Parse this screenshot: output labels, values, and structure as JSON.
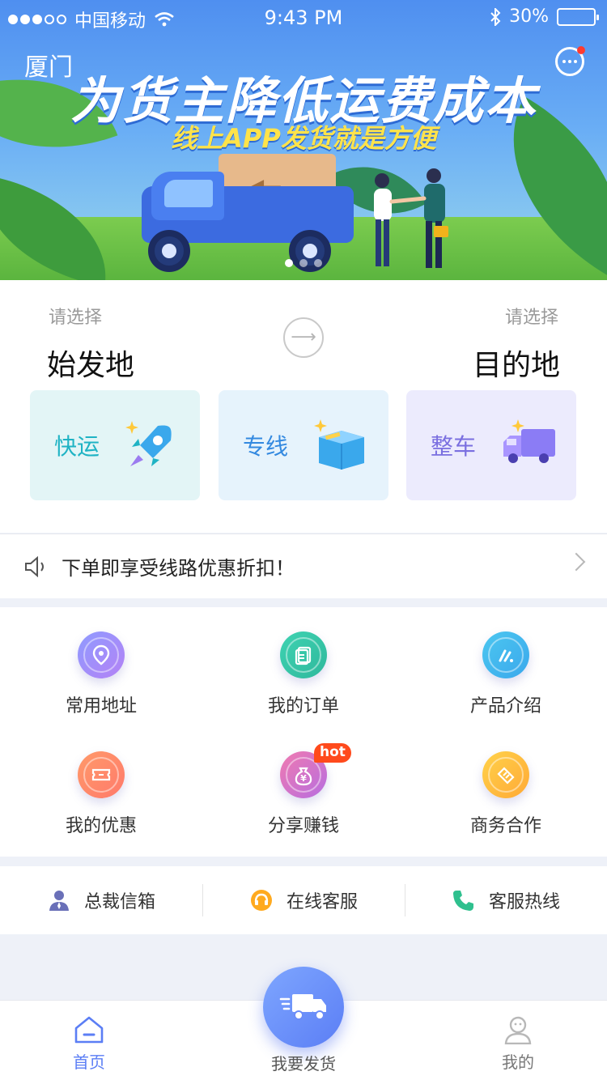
{
  "status_bar": {
    "carrier": "中国移动",
    "time": "9:43 PM",
    "battery": "30%",
    "battery_level": 0.3
  },
  "banner": {
    "city": "厦门",
    "headline": "为货主降低运费成本",
    "subline": "线上APP发货就是方便",
    "carousel": {
      "count": 3,
      "active": 0
    }
  },
  "route": {
    "origin_hint": "请选择",
    "origin": "始发地",
    "destination_hint": "请选择",
    "destination": "目的地"
  },
  "services": [
    {
      "label": "快运",
      "icon": "rocket-icon",
      "color": "#1fb3c4",
      "bg": "#e3f5f6"
    },
    {
      "label": "专线",
      "icon": "box-icon",
      "color": "#3389e0",
      "bg": "#e6f3fc"
    },
    {
      "label": "整车",
      "icon": "truck-icon",
      "color": "#7a6fe0",
      "bg": "#ecebfd"
    }
  ],
  "notice": {
    "text": "下单即享受线路优惠折扣！"
  },
  "grid": [
    {
      "label": "常用地址",
      "icon": "location-icon",
      "color1": "#8f9bff",
      "color2": "#b482f5"
    },
    {
      "label": "我的订单",
      "icon": "document-icon",
      "color1": "#3ed3b2",
      "color2": "#2fb89c"
    },
    {
      "label": "产品介绍",
      "icon": "info-icon",
      "color1": "#4cc7f0",
      "color2": "#3aa8ec"
    },
    {
      "label": "我的优惠",
      "icon": "ticket-icon",
      "color1": "#ff9a6a",
      "color2": "#ff7a6b"
    },
    {
      "label": "分享赚钱",
      "icon": "money-bag-icon",
      "color1": "#f07ab0",
      "color2": "#b76ee0",
      "badge": "hot"
    },
    {
      "label": "商务合作",
      "icon": "handshake-icon",
      "color1": "#ffd24a",
      "color2": "#ffa936"
    }
  ],
  "links": [
    {
      "label": "总裁信箱",
      "icon": "person-icon",
      "color": "#6a70b8"
    },
    {
      "label": "在线客服",
      "icon": "headset-icon",
      "color": "#ffaa1f"
    },
    {
      "label": "客服热线",
      "icon": "phone-icon",
      "color": "#2fc08e"
    }
  ],
  "tabbar": {
    "home": "首页",
    "ship": "我要发货",
    "mine": "我的",
    "active_color": "#5b7ef5"
  }
}
